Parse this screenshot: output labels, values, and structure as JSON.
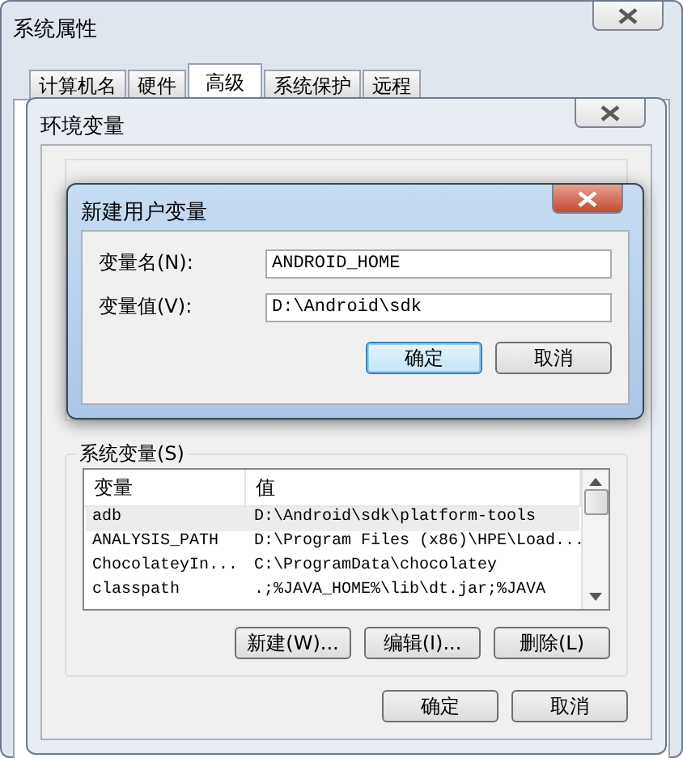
{
  "window": {
    "title": "系统属性"
  },
  "tabs": [
    {
      "label": "计算机名",
      "selected": false
    },
    {
      "label": "硬件",
      "selected": false
    },
    {
      "label": "高级",
      "selected": true
    },
    {
      "label": "系统保护",
      "selected": false
    },
    {
      "label": "远程",
      "selected": false
    }
  ],
  "env_dialog": {
    "title": "环境变量",
    "system_group": {
      "label": "系统变量(S)",
      "columns": [
        "变量",
        "值"
      ],
      "rows": [
        {
          "name": "adb",
          "value": "D:\\Android\\sdk\\platform-tools",
          "selected": true
        },
        {
          "name": "ANALYSIS_PATH",
          "value": "D:\\Program Files (x86)\\HPE\\Load...",
          "selected": false
        },
        {
          "name": "ChocolateyIn...",
          "value": "C:\\ProgramData\\chocolatey",
          "selected": false
        },
        {
          "name": "classpath",
          "value": ".;%JAVA_HOME%\\lib\\dt.jar;%JAVA",
          "selected": false
        }
      ],
      "buttons": [
        "新建(W)...",
        "编辑(I)...",
        "删除(L)"
      ]
    },
    "buttons": [
      "确定",
      "取消"
    ]
  },
  "new_var_dialog": {
    "title": "新建用户变量",
    "fields": [
      {
        "label": "变量名(N):",
        "value": "ANDROID_HOME"
      },
      {
        "label": "变量值(V):",
        "value": "D:\\Android\\sdk"
      }
    ],
    "buttons": [
      {
        "label": "确定",
        "selected": true
      },
      {
        "label": "取消",
        "selected": false
      }
    ]
  }
}
